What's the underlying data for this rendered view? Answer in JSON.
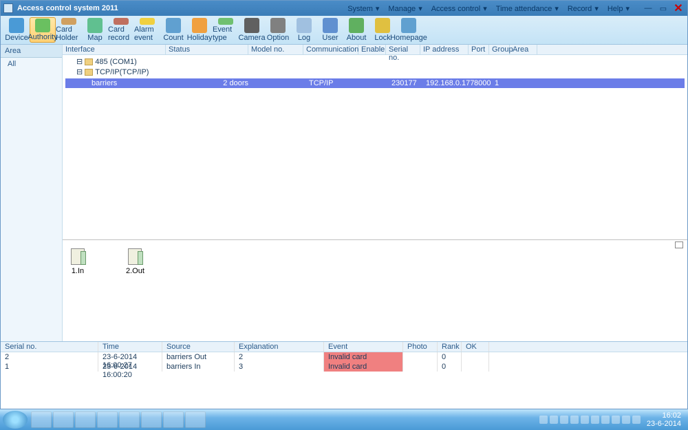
{
  "title": "Access control system 2011",
  "menubar": [
    "System",
    "Manage",
    "Access control",
    "Time attendance",
    "Record",
    "Help"
  ],
  "toolbar": [
    {
      "label": "Device",
      "color": "#4a9ad6",
      "sel": false
    },
    {
      "label": "Authority",
      "color": "#6ac060",
      "sel": true
    },
    {
      "label": "Card Holder",
      "color": "#d0a060",
      "sel": false
    },
    {
      "label": "Map",
      "color": "#60c090",
      "sel": false
    },
    {
      "label": "Card record",
      "color": "#c07060",
      "sel": false
    },
    {
      "label": "Alarm event",
      "color": "#f0d040",
      "sel": false
    },
    {
      "label": "Count",
      "color": "#60a0d0",
      "sel": false
    },
    {
      "label": "Holiday",
      "color": "#f0a040",
      "sel": false
    },
    {
      "label": "Event type",
      "color": "#70c070",
      "sel": false
    },
    {
      "label": "Camera",
      "color": "#606060",
      "sel": false
    },
    {
      "label": "Option",
      "color": "#808080",
      "sel": false
    },
    {
      "label": "Log",
      "color": "#a0c0e0",
      "sel": false
    },
    {
      "label": "User",
      "color": "#6090d0",
      "sel": false
    },
    {
      "label": "About",
      "color": "#60b060",
      "sel": false
    },
    {
      "label": "Lock",
      "color": "#e0c040",
      "sel": false
    },
    {
      "label": "Homepage",
      "color": "#60a0d0",
      "sel": false
    }
  ],
  "sidebar": {
    "header": "Area",
    "root": "All"
  },
  "grid_headers": {
    "interface": "Interface",
    "status": "Status",
    "model": "Model no.",
    "comm": "Communication",
    "enable": "Enable",
    "serial": "Serial no.",
    "ip": "IP address",
    "port": "Port",
    "group": "Group",
    "area": "Area"
  },
  "tree": [
    {
      "label": "485 (COM1)",
      "indent": 1
    },
    {
      "label": "TCP/IP(TCP/IP)",
      "indent": 1
    },
    {
      "label": "barriers",
      "indent": 2,
      "selected": true
    }
  ],
  "selected_row": {
    "interface": "barriers",
    "status": "2 doors",
    "comm": "TCP/IP",
    "serial": "230177",
    "ip": "192.168.0.177",
    "port": "8000",
    "group": "1"
  },
  "doors": [
    {
      "label": "1.In"
    },
    {
      "label": "2.Out"
    }
  ],
  "event_headers": {
    "sn": "Serial no.",
    "time": "Time",
    "source": "Source",
    "expl": "Explanation",
    "event": "Event",
    "photo": "Photo",
    "rank": "Rank",
    "ok": "OK"
  },
  "events": [
    {
      "sn": "2",
      "time": "23-6-2014 16:00:27",
      "source": "barriers Out",
      "expl": "2",
      "event": "Invalid card",
      "rank": "0"
    },
    {
      "sn": "1",
      "time": "23-6-2014 16:00:20",
      "source": "barriers In",
      "expl": "3",
      "event": "Invalid card",
      "rank": "0"
    }
  ],
  "taskbar_apps": 8,
  "tray_icons": 10,
  "clock": {
    "time": "16:02",
    "date": "23-6-2014"
  }
}
